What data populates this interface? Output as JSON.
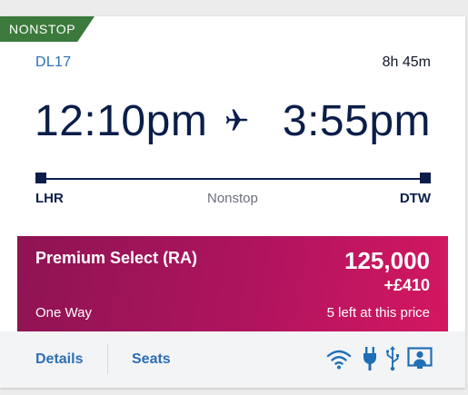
{
  "badge": {
    "label": "NONSTOP"
  },
  "flight": {
    "number": "DL17",
    "duration": "8h 45m",
    "departure_time": "12:10pm",
    "arrival_time": "3:55pm",
    "origin": "LHR",
    "destination": "DTW",
    "stops": "Nonstop"
  },
  "fare": {
    "cabin": "Premium Select (RA)",
    "miles": "125,000",
    "cash": "+£410",
    "trip_type": "One Way",
    "availability": "5 left at this price",
    "colors": {
      "start": "#8e1453",
      "end": "#d41761"
    }
  },
  "footer": {
    "details_label": "Details",
    "seats_label": "Seats",
    "amenities": [
      "wifi-icon",
      "power-outlet-icon",
      "usb-icon",
      "personal-entertainment-icon"
    ]
  },
  "colors": {
    "navy": "#0b1e4a",
    "link_blue": "#2d6fb4",
    "nonstop_green": "#3b7a3c"
  }
}
